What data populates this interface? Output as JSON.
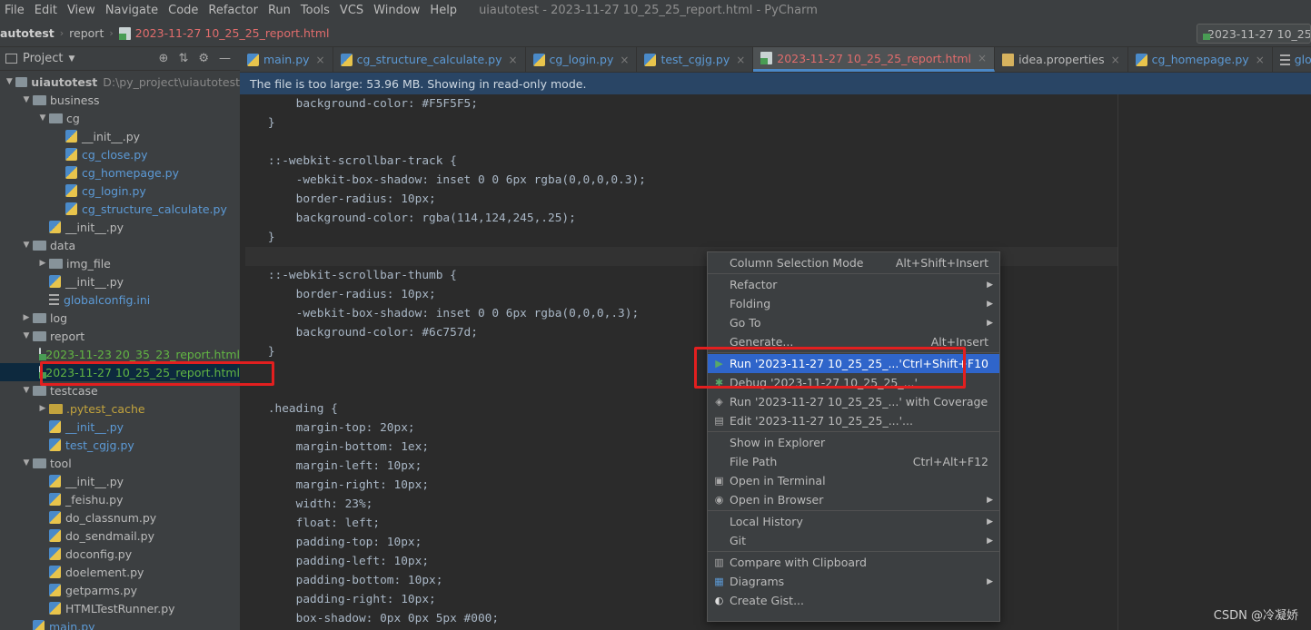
{
  "menu": [
    "File",
    "Edit",
    "View",
    "Navigate",
    "Code",
    "Refactor",
    "Run",
    "Tools",
    "VCS",
    "Window",
    "Help"
  ],
  "window_title": "uiautotest - 2023-11-27 10_25_25_report.html - PyCharm",
  "breadcrumb": [
    "autotest",
    "report",
    "2023-11-27 10_25_25_report.html"
  ],
  "run_config": "2023-11-27 10_25",
  "project_panel": {
    "title": "Project",
    "tree": [
      {
        "label": "uiautotest",
        "path": "D:\\py_project\\uiautotest",
        "type": "folder",
        "depth": 0,
        "expanded": true
      },
      {
        "label": "business",
        "type": "folder",
        "depth": 1,
        "expanded": true
      },
      {
        "label": "cg",
        "type": "folder",
        "depth": 2,
        "expanded": true
      },
      {
        "label": "__init__.py",
        "type": "py",
        "depth": 3
      },
      {
        "label": "cg_close.py",
        "type": "py",
        "depth": 3,
        "color": "blue"
      },
      {
        "label": "cg_homepage.py",
        "type": "py",
        "depth": 3,
        "color": "blue"
      },
      {
        "label": "cg_login.py",
        "type": "py",
        "depth": 3,
        "color": "blue"
      },
      {
        "label": "cg_structure_calculate.py",
        "type": "py",
        "depth": 3,
        "color": "blue"
      },
      {
        "label": "__init__.py",
        "type": "py",
        "depth": 2
      },
      {
        "label": "data",
        "type": "folder",
        "depth": 1,
        "expanded": true
      },
      {
        "label": "img_file",
        "type": "folder",
        "depth": 2
      },
      {
        "label": "__init__.py",
        "type": "py",
        "depth": 2
      },
      {
        "label": "globalconfig.ini",
        "type": "ini",
        "depth": 2,
        "color": "blue"
      },
      {
        "label": "log",
        "type": "folder",
        "depth": 1,
        "expanded": false
      },
      {
        "label": "report",
        "type": "folder",
        "depth": 1,
        "expanded": true
      },
      {
        "label": "2023-11-23 20_35_23_report.html",
        "type": "html",
        "depth": 2
      },
      {
        "label": "2023-11-27 10_25_25_report.html",
        "type": "html",
        "depth": 2,
        "selected": true
      },
      {
        "label": "testcase",
        "type": "folder",
        "depth": 1,
        "expanded": true
      },
      {
        "label": ".pytest_cache",
        "type": "folder-excluded",
        "depth": 2,
        "color": "orange",
        "expanded": false
      },
      {
        "label": "__init__.py",
        "type": "py",
        "depth": 2,
        "color": "blue"
      },
      {
        "label": "test_cgjg.py",
        "type": "py",
        "depth": 2,
        "color": "blue"
      },
      {
        "label": "tool",
        "type": "folder",
        "depth": 1,
        "expanded": true
      },
      {
        "label": "__init__.py",
        "type": "py",
        "depth": 2
      },
      {
        "label": "_feishu.py",
        "type": "py",
        "depth": 2
      },
      {
        "label": "do_classnum.py",
        "type": "py",
        "depth": 2
      },
      {
        "label": "do_sendmail.py",
        "type": "py",
        "depth": 2
      },
      {
        "label": "doconfig.py",
        "type": "py",
        "depth": 2
      },
      {
        "label": "doelement.py",
        "type": "py",
        "depth": 2
      },
      {
        "label": "getparms.py",
        "type": "py",
        "depth": 2
      },
      {
        "label": "HTMLTestRunner.py",
        "type": "py",
        "depth": 2
      },
      {
        "label": "main.py",
        "type": "py",
        "depth": 1,
        "color": "blue"
      }
    ]
  },
  "tabs": [
    {
      "label": "main.py",
      "icon": "py"
    },
    {
      "label": "cg_structure_calculate.py",
      "icon": "py"
    },
    {
      "label": "cg_login.py",
      "icon": "py"
    },
    {
      "label": "test_cgjg.py",
      "icon": "py"
    },
    {
      "label": "2023-11-27 10_25_25_report.html",
      "icon": "html",
      "active": true
    },
    {
      "label": "idea.properties",
      "icon": "properties",
      "plain": true
    },
    {
      "label": "cg_homepage.py",
      "icon": "py"
    },
    {
      "label": "globalconfig.ini",
      "icon": "ini"
    }
  ],
  "banner": "The file is too large: 53.96 MB. Showing in read-only mode.",
  "code_lines": [
    "        background-color: #F5F5F5;",
    "    }",
    "",
    "    ::-webkit-scrollbar-track {",
    "        -webkit-box-shadow: inset 0 0 6px rgba(0,0,0,0.3);",
    "        border-radius: 10px;",
    "        background-color: rgba(114,124,245,.25);",
    "    }",
    "",
    "    ::-webkit-scrollbar-thumb {",
    "        border-radius: 10px;",
    "        -webkit-box-shadow: inset 0 0 6px rgba(0,0,0,.3);",
    "        background-color: #6c757d;",
    "    }",
    "",
    "",
    "    .heading {",
    "        margin-top: 20px;",
    "        margin-bottom: 1ex;",
    "        margin-left: 10px;",
    "        margin-right: 10px;",
    "        width: 23%;",
    "        float: left;",
    "        padding-top: 10px;",
    "        padding-left: 10px;",
    "        padding-bottom: 10px;",
    "        padding-right: 10px;",
    "        box-shadow: 0px 0px 5px #000;",
    "    }"
  ],
  "context_menu": [
    {
      "label": "Column Selection Mode",
      "shortcut": "Alt+Shift+Insert"
    },
    {
      "label": "Refactor",
      "submenu": true
    },
    {
      "label": "Folding",
      "submenu": true
    },
    {
      "label": "Go To",
      "submenu": true
    },
    {
      "label": "Generate...",
      "shortcut": "Alt+Insert"
    },
    {
      "label": "Run '2023-11-27 10_25_25_...'",
      "shortcut": "Ctrl+Shift+F10",
      "icon": "run",
      "highlighted": true
    },
    {
      "label": "Debug '2023-11-27 10_25_25_...'",
      "icon": "debug"
    },
    {
      "label": "Run '2023-11-27 10_25_25_...' with Coverage",
      "icon": "coverage"
    },
    {
      "label": "Edit '2023-11-27 10_25_25_...'...",
      "icon": "edit"
    },
    {
      "label": "Show in Explorer"
    },
    {
      "label": "File Path",
      "shortcut": "Ctrl+Alt+F12"
    },
    {
      "label": "Open in Terminal",
      "icon": "terminal"
    },
    {
      "label": "Open in Browser",
      "icon": "globe",
      "submenu": true
    },
    {
      "label": "Local History",
      "submenu": true
    },
    {
      "label": "Git",
      "submenu": true
    },
    {
      "label": "Compare with Clipboard",
      "icon": "compare"
    },
    {
      "label": "Diagrams",
      "icon": "diagram",
      "submenu": true
    },
    {
      "label": "Create Gist...",
      "icon": "github"
    }
  ],
  "watermark": "CSDN @冷凝娇"
}
